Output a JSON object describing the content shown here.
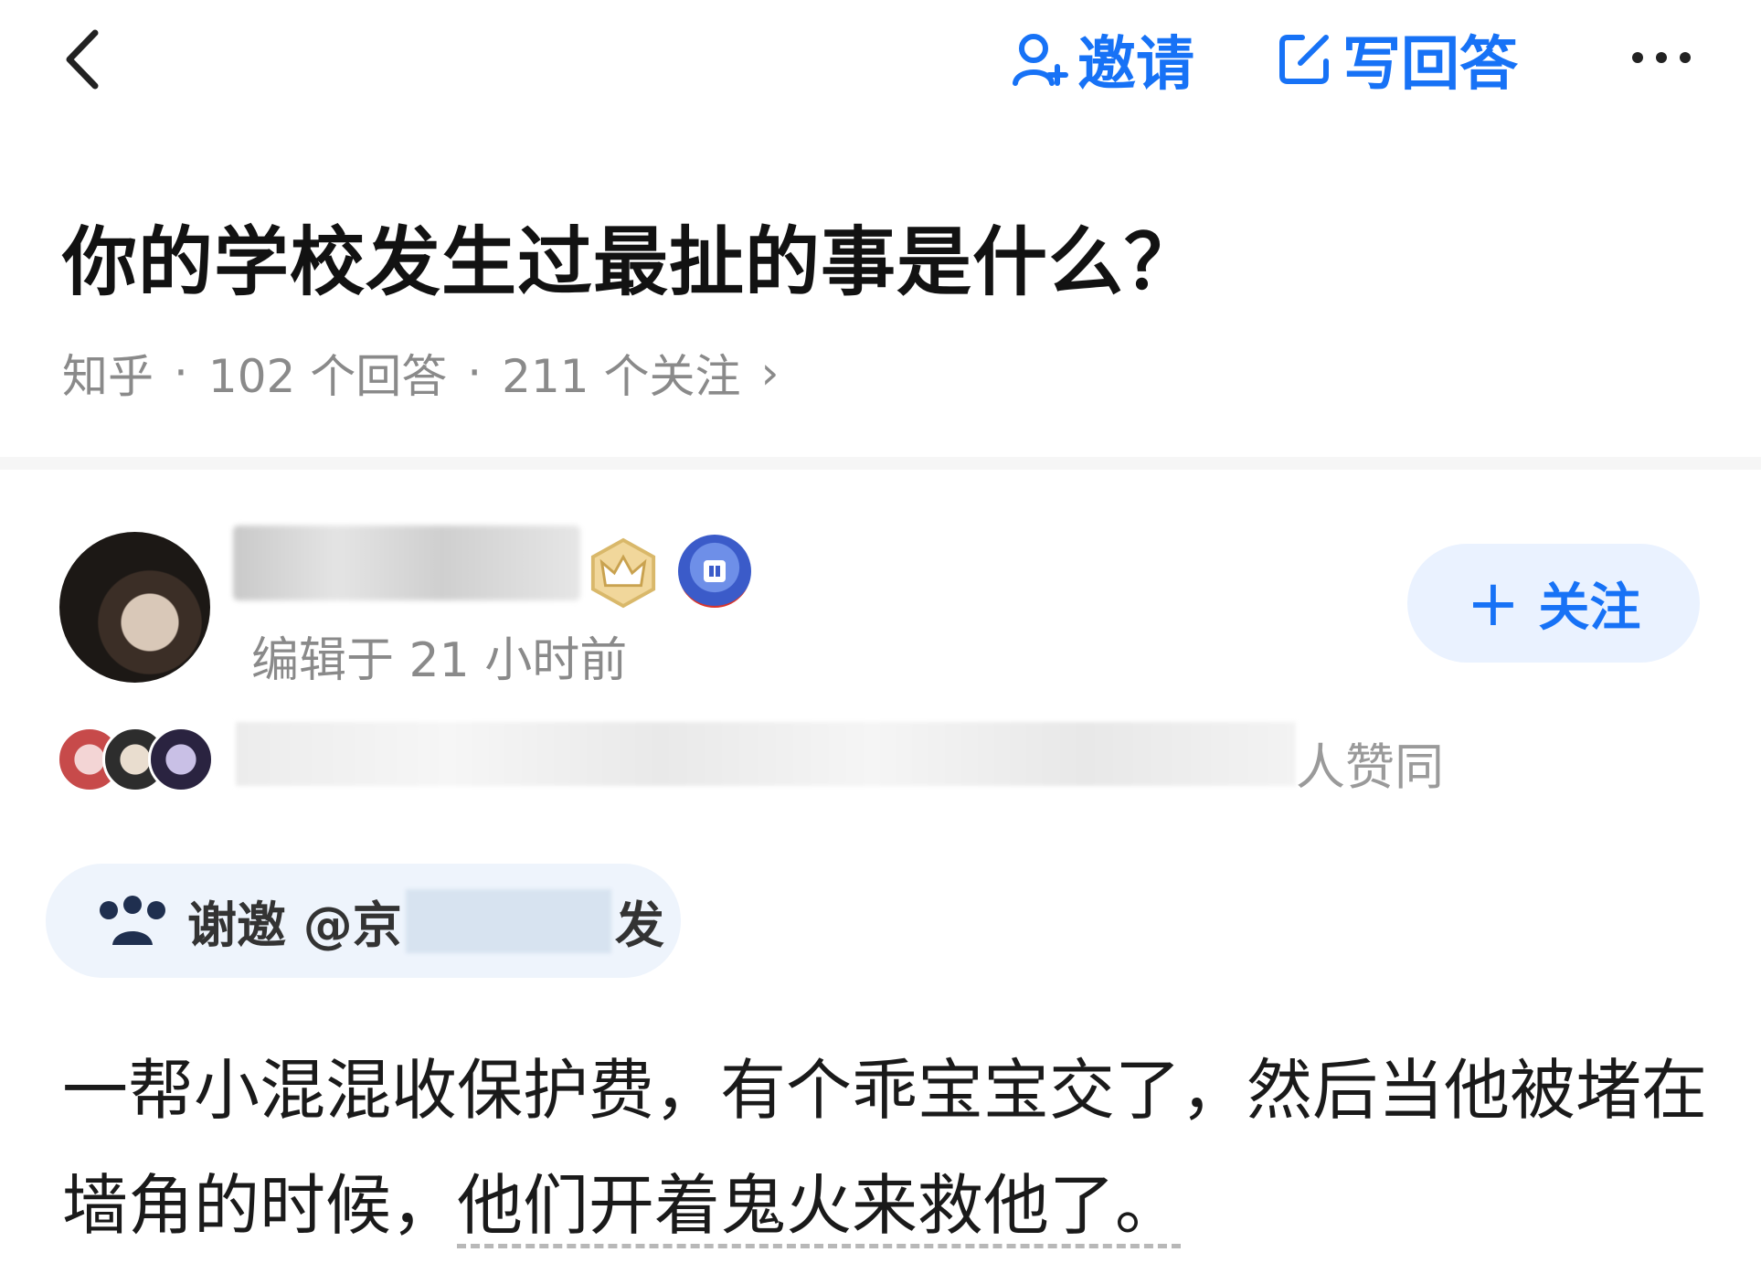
{
  "topbar": {
    "back_icon": "chevron-left-icon",
    "invite_label": "邀请",
    "invite_icon": "person-plus-icon",
    "write_label": "写回答",
    "write_icon": "edit-icon",
    "more_icon": "more-dots-icon"
  },
  "question": {
    "title": "你的学校发生过最扯的事是什么？",
    "source": "知乎",
    "answers": "102 个回答",
    "followers": "211 个关注",
    "sep": "·",
    "chevron": "›"
  },
  "author": {
    "edited": "编辑于 21 小时前",
    "follow_label": "关注",
    "follow_plus": "+"
  },
  "voters": {
    "tail_text": "人赞同"
  },
  "invitation": {
    "prefix": "谢邀 @京",
    "suffix": "发"
  },
  "answer": {
    "text_main": "一帮小混混收保护费，有个乖宝宝交了，然后当他被堵在墙角的时候，",
    "text_underlined": "他们开着鬼火来救他了。"
  },
  "colors": {
    "accent": "#1772f6",
    "follow_bg": "#eaf2ff",
    "meta_gray": "#8a8a8a"
  }
}
